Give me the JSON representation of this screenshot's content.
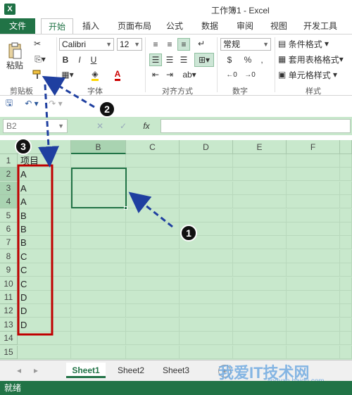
{
  "window": {
    "title": "工作簿1 - Excel"
  },
  "tabs": [
    "文件",
    "开始",
    "插入",
    "页面布局",
    "公式",
    "数据",
    "审阅",
    "视图",
    "开发工具"
  ],
  "ribbon": {
    "paste_label": "粘贴",
    "font_name": "Calibri",
    "font_size": "12",
    "number_format": "常规",
    "bold": "B",
    "italic": "I",
    "underline": "U",
    "cond_format": "条件格式",
    "table_format": "套用表格格式",
    "cell_style": "单元格样式",
    "groups": {
      "clipboard": "剪贴板",
      "font": "字体",
      "align": "对齐方式",
      "number": "数字",
      "styles": "样式"
    },
    "percent": "%",
    "comma": ",",
    "currency": "$"
  },
  "formula_bar": {
    "name_box": "B2",
    "fx": "fx",
    "content": ""
  },
  "columns": [
    "B",
    "C",
    "D",
    "E",
    "F"
  ],
  "rows": [
    "1",
    "2",
    "3",
    "4",
    "5",
    "6",
    "7",
    "8",
    "9",
    "10",
    "11",
    "12",
    "13",
    "14",
    "15"
  ],
  "column_a": [
    "项目",
    "A",
    "A",
    "A",
    "B",
    "B",
    "B",
    "C",
    "C",
    "C",
    "D",
    "D",
    "D",
    "",
    ""
  ],
  "selected_cell": "B2",
  "sheets": [
    "Sheet1",
    "Sheet2",
    "Sheet3"
  ],
  "active_sheet": "Sheet1",
  "status": "就绪",
  "annotations": [
    "1",
    "2",
    "3"
  ],
  "watermark": "我爱IT技术网",
  "watermark_sub": "jingyan.baidu.com",
  "colors": {
    "excel_green": "#217346",
    "grid_bg": "#c8e8cc",
    "highlight_red": "#c00000",
    "arrow_blue": "#1f3fa0"
  }
}
